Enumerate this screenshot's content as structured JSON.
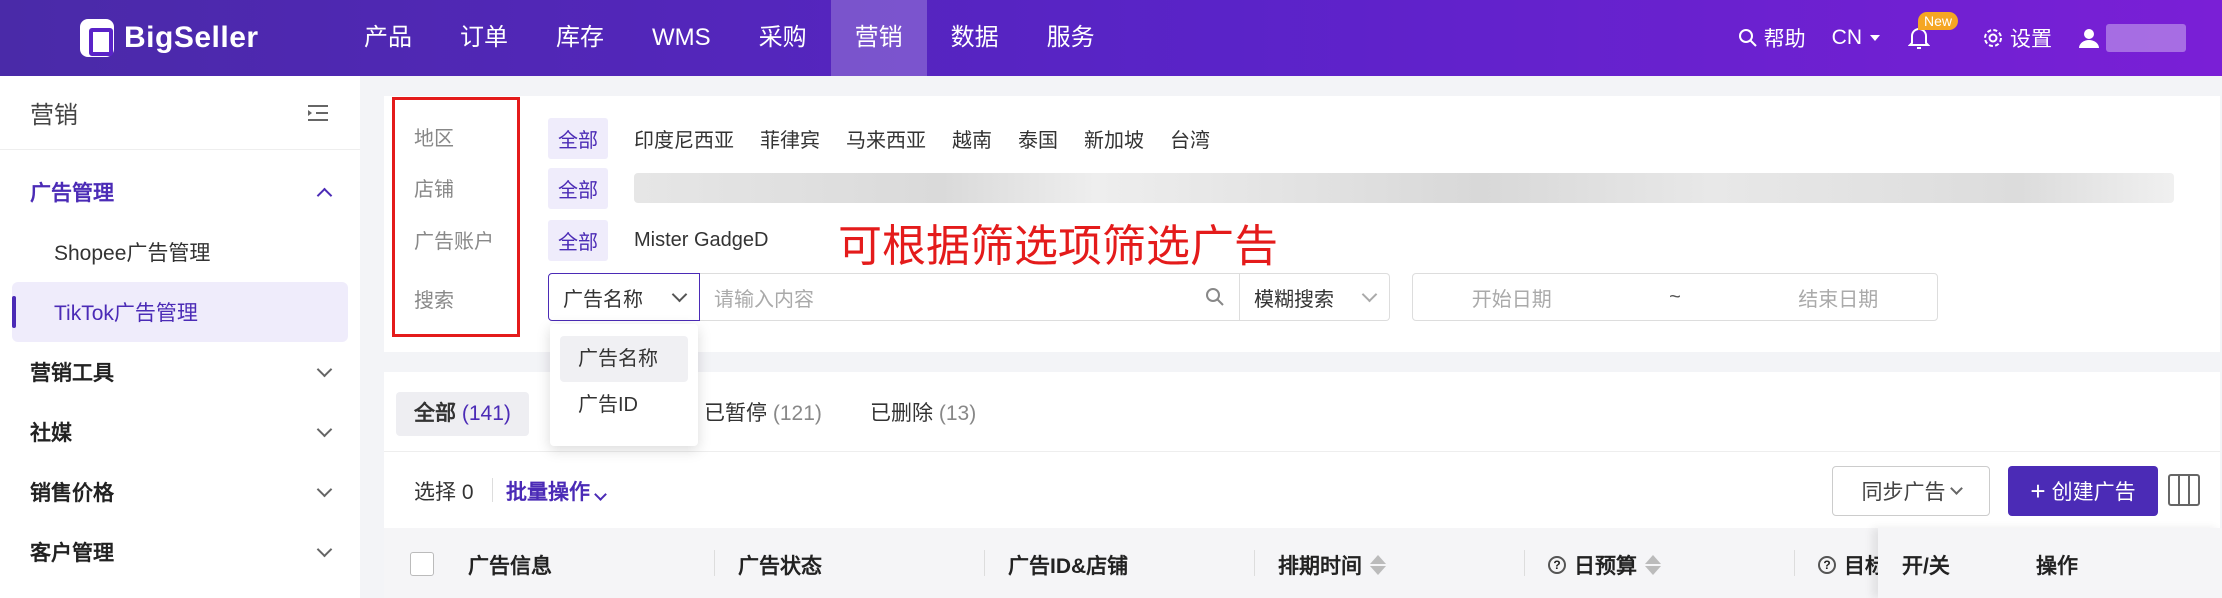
{
  "brand": {
    "name": "BigSeller"
  },
  "nav": {
    "items": [
      "产品",
      "订单",
      "库存",
      "WMS",
      "采购",
      "营销",
      "数据",
      "服务"
    ],
    "active_index": 5
  },
  "top_right": {
    "help": "帮助",
    "lang": "CN",
    "new_badge": "New",
    "settings": "设置"
  },
  "sidebar": {
    "title": "营销",
    "groups": [
      {
        "label": "广告管理",
        "open": true,
        "items": [
          "Shopee广告管理",
          "TikTok广告管理"
        ],
        "active_item": 1
      },
      {
        "label": "营销工具"
      },
      {
        "label": "社媒"
      },
      {
        "label": "销售价格"
      },
      {
        "label": "客户管理"
      }
    ]
  },
  "filters": {
    "region_label": "地区",
    "store_label": "店铺",
    "account_label": "广告账户",
    "search_label": "搜索",
    "all": "全部",
    "regions": [
      "印度尼西亚",
      "菲律宾",
      "马来西亚",
      "越南",
      "泰国",
      "新加坡",
      "台湾"
    ],
    "account": "Mister GadgeD",
    "annotation": "可根据筛选项筛选广告",
    "search_field": "广告名称",
    "search_placeholder": "请输入内容",
    "match_mode": "模糊搜索",
    "start_date": "开始日期",
    "date_sep": "~",
    "end_date": "结束日期",
    "dropdown_options": [
      "广告名称",
      "广告ID"
    ]
  },
  "tabs": [
    {
      "label": "全部",
      "count": "(141)"
    },
    {
      "label": "已暂停",
      "count": "(121)"
    },
    {
      "label": "已删除",
      "count": "(13)"
    }
  ],
  "toolbar": {
    "selected": "选择 0",
    "batch": "批量操作",
    "sync": "同步广告",
    "create": "创建广告"
  },
  "table": {
    "columns": [
      "广告信息",
      "广告状态",
      "广告ID&店铺",
      "排期时间",
      "日预算",
      "目标",
      "开/关",
      "操作"
    ]
  },
  "colors": {
    "brand": "#4b2bb6",
    "annotation": "#e41b1b"
  }
}
